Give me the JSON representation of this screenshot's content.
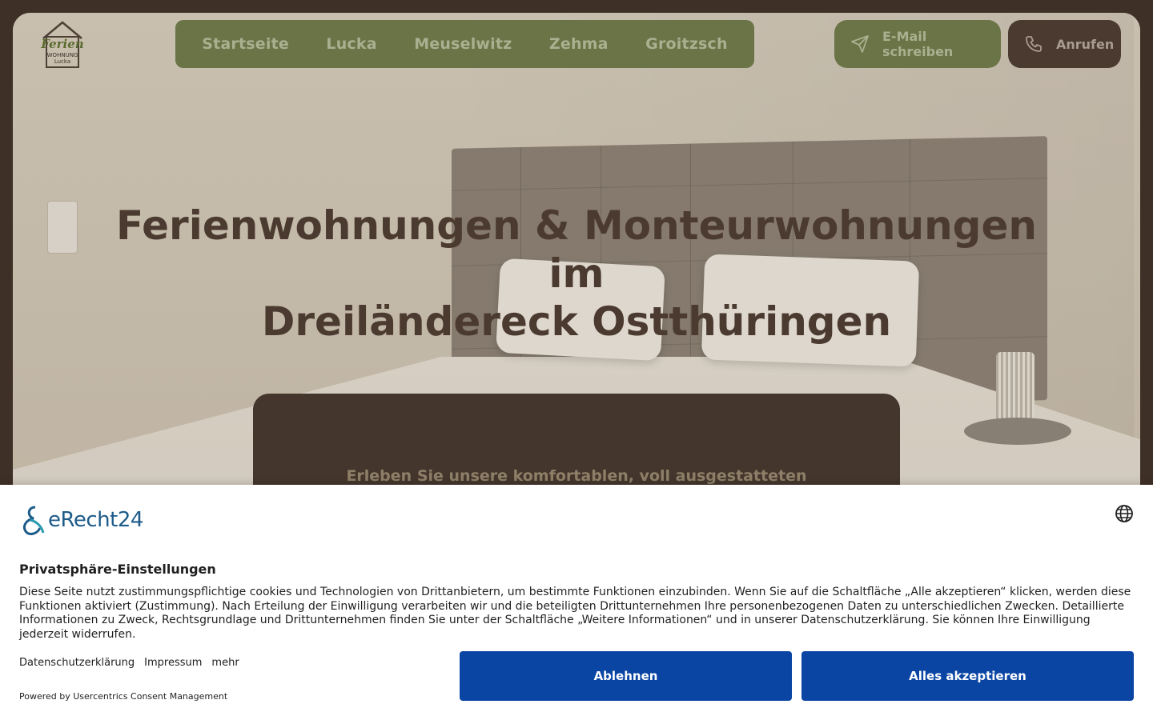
{
  "header": {
    "logo": {
      "text_line1": "Ferien",
      "text_line2": "WOHNUNG",
      "text_line3": "Lucka"
    },
    "nav": [
      {
        "label": "Startseite"
      },
      {
        "label": "Lucka"
      },
      {
        "label": "Meuselwitz"
      },
      {
        "label": "Zehma"
      },
      {
        "label": "Groitzsch"
      }
    ],
    "email_button": {
      "label": "E-Mail schreiben",
      "icon": "send-icon"
    },
    "call_button": {
      "label": "Anrufen",
      "icon": "phone-icon"
    }
  },
  "hero": {
    "title_line1": "Ferienwohnungen & Monteurwohnungen",
    "title_line2": "im",
    "title_line3": "Dreiländereck Ostthüringen",
    "subtitle": "Erleben Sie unsere komfortablen, voll ausgestatteten"
  },
  "consent": {
    "brand": "eRecht24",
    "language_icon": "globe-icon",
    "title": "Privatsphäre-Einstellungen",
    "text": "Diese Seite nutzt zustimmungspflichtige cookies und Technologien von Drittanbietern, um bestimmte Funktionen einzubinden. Wenn Sie auf die Schaltfläche „Alle akzeptieren“ klicken, werden diese Funktionen aktiviert (Zustimmung). Nach Erteilung der Einwilligung verarbeiten wir und die beteiligten Drittunternehmen Ihre personenbezogenen Daten zu unterschiedlichen Zwecken. Detaillierte Informationen zu Zweck, Rechtsgrundlage und Drittunternehmen finden Sie unter der Schaltfläche „Weitere Informationen“ und in unserer Datenschutzerklärung. Sie können Ihre Einwilligung jederzeit widerrufen.",
    "links": [
      "Datenschutzerklärung",
      "Impressum",
      "mehr"
    ],
    "powered_by": "Powered by Usercentrics Consent Management",
    "decline_label": "Ablehnen",
    "accept_label": "Alles akzeptieren"
  },
  "colors": {
    "page_bg": "#3f3027",
    "nav_green": "#6a7447",
    "call_brown": "#4a3a30",
    "consent_button": "#0a45a4",
    "brand_blue": "#1d5c8a"
  }
}
